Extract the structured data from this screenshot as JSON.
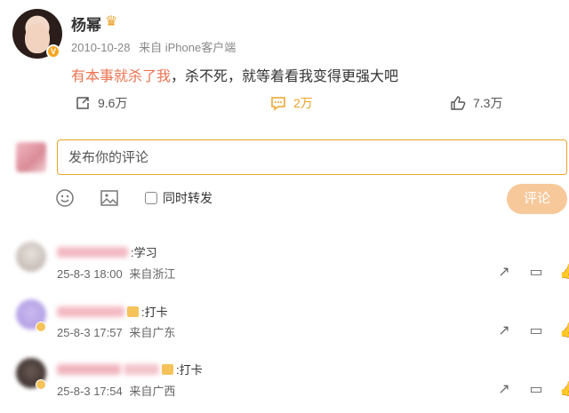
{
  "post": {
    "author": "杨幂",
    "date": "2010-10-28",
    "source": "来自 iPhone客户端",
    "text_highlight": "有本事就杀了我",
    "text_rest": "，杀不死，就等着看我变得更强大吧",
    "repost_count": "9.6万",
    "comment_count": "2万",
    "like_count": "7.3万"
  },
  "composer": {
    "placeholder": "发布你的评论",
    "repost_label": "同时转发",
    "submit_label": "评论"
  },
  "comments": [
    {
      "text": ":学习",
      "time": "25-8-3 18:00",
      "location": "来自浙江"
    },
    {
      "text": ":打卡",
      "time": "25-8-3 17:57",
      "location": "来自广东"
    },
    {
      "text": ":打卡",
      "time": "25-8-3 17:54",
      "location": "来自广西"
    }
  ],
  "icons": {
    "vip": "crown-icon",
    "repost": "repost-icon",
    "comment": "comment-icon",
    "like": "thumb-up-icon",
    "emoji": "smiley-icon",
    "image": "image-icon",
    "accent": "#e8a42a",
    "highlight": "#eb7350"
  }
}
